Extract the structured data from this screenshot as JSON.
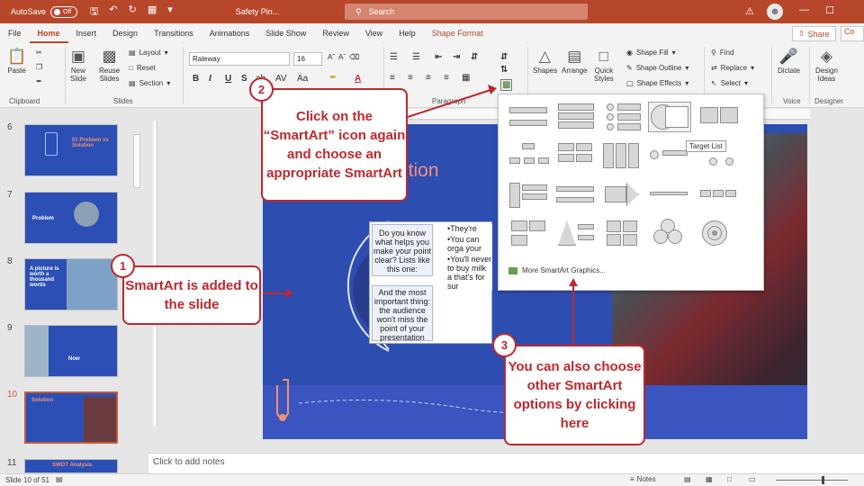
{
  "titlebar": {
    "autosave_label": "AutoSave",
    "autosave_state": "Off",
    "doc_name": "Safety Pin...",
    "search_placeholder": "Search",
    "accent": "#b7472a"
  },
  "menu": {
    "tabs": [
      "File",
      "Home",
      "Insert",
      "Design",
      "Transitions",
      "Animations",
      "Slide Show",
      "Review",
      "View",
      "Help",
      "Shape Format"
    ],
    "active": "Home",
    "share": "Share",
    "comments": "Co"
  },
  "ribbon": {
    "clipboard": {
      "paste": "Paste",
      "label": "Clipboard"
    },
    "slides": {
      "new_slide_1": "New",
      "new_slide_2": "Slide",
      "reuse_1": "Reuse",
      "reuse_2": "Slides",
      "layout": "Layout",
      "reset": "Reset",
      "section": "Section",
      "label": "Slides"
    },
    "font": {
      "name": "Raleway",
      "size": "16",
      "bold": "B",
      "italic": "I",
      "underline": "U",
      "strike": "S"
    },
    "paragraph": {
      "label": "Paragraph"
    },
    "drawing": {
      "shapes": "Shapes",
      "arrange": "Arrange",
      "quick_1": "Quick",
      "quick_2": "Styles",
      "fill": "Shape Fill",
      "outline": "Shape Outline",
      "effects": "Shape Effects"
    },
    "editing": {
      "find": "Find",
      "replace": "Replace",
      "select": "Select"
    },
    "voice": {
      "dictate": "Dictate",
      "label": "Voice"
    },
    "designer": {
      "ideas_1": "Design",
      "ideas_2": "Ideas",
      "label": "Designer"
    }
  },
  "thumbnails": [
    {
      "number": "6",
      "title": "01 Problem vs Solution"
    },
    {
      "number": "7",
      "title": "Problem"
    },
    {
      "number": "8",
      "title": "A picture is worth a thousand words"
    },
    {
      "number": "9",
      "title": "Now"
    },
    {
      "number": "10",
      "title": "Solution"
    },
    {
      "number": "11",
      "title": "SWOT Analysis"
    }
  ],
  "slide": {
    "title_fragment": "ution",
    "smartart_cells": [
      "Do you know what helps you make your point clear? Lists like this one:",
      "And the most important thing: the audience won't miss the point of your presentation"
    ],
    "smartart_bullets": [
      "•They're simp",
      "•You can orga your ideas cl",
      "•You'll never to buy milk a that's for sur"
    ]
  },
  "gallery": {
    "tooltip": "Target List",
    "more": "More SmartArt Graphics..."
  },
  "callouts": [
    {
      "badge": "1",
      "text": "SmartArt is added to the slide"
    },
    {
      "badge": "2",
      "text": "Click on the “SmartArt” icon again and choose an appropriate SmartArt"
    },
    {
      "badge": "3",
      "text": "You can also choose other SmartArt options by clicking here"
    }
  ],
  "notes_placeholder": "Click to add notes",
  "status": {
    "slide_counter": "Slide 10 of 51",
    "notes_button": "Notes"
  }
}
